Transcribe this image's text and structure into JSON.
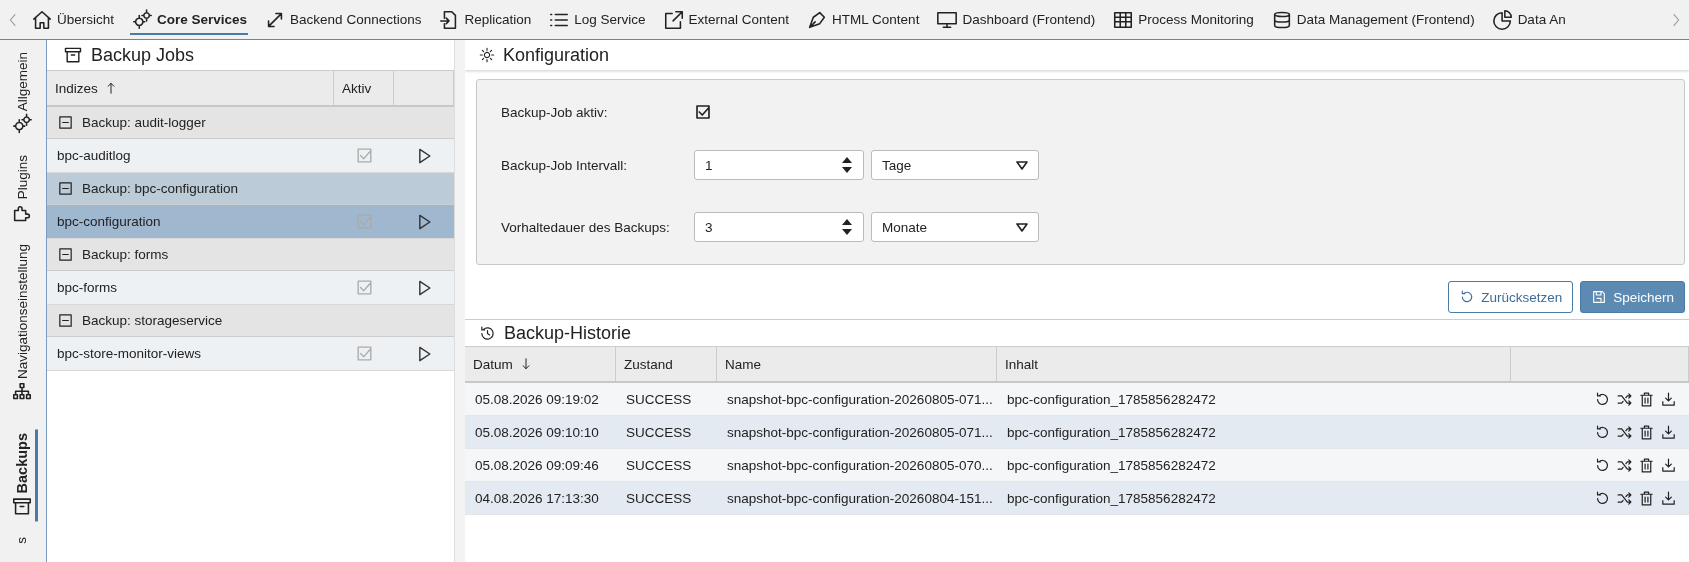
{
  "tab_bar": {
    "tabs": [
      {
        "label": "Übersicht",
        "selected": false
      },
      {
        "label": "Core Services",
        "selected": true
      },
      {
        "label": "Backend Connections",
        "selected": false
      },
      {
        "label": "Replication",
        "selected": false
      },
      {
        "label": "Log Service",
        "selected": false
      },
      {
        "label": "External Content",
        "selected": false
      },
      {
        "label": "HTML Content",
        "selected": false
      },
      {
        "label": "Dashboard (Frontend)",
        "selected": false
      },
      {
        "label": "Process Monitoring",
        "selected": false
      },
      {
        "label": "Data Management (Frontend)",
        "selected": false
      },
      {
        "label": "Data An",
        "selected": false
      }
    ]
  },
  "side_nav": {
    "items": [
      {
        "label": "Allgemein",
        "selected": false
      },
      {
        "label": "Plugins",
        "selected": false
      },
      {
        "label": "Navigationseinstellung",
        "selected": false
      },
      {
        "label": "Backups",
        "selected": true
      },
      {
        "label": "s",
        "selected": false
      }
    ]
  },
  "backup_jobs": {
    "title": "Backup Jobs",
    "columns": [
      {
        "label": "Indizes",
        "sorted": true,
        "ascending": true
      },
      {
        "label": "Aktiv",
        "sorted": false
      }
    ],
    "groups": [
      {
        "label": "Backup: audit-logger",
        "expanded": true,
        "jobs": [
          {
            "name": "bpc-auditlog",
            "active": true,
            "selected": false
          }
        ]
      },
      {
        "label": "Backup: bpc-configuration",
        "expanded": true,
        "jobs": [
          {
            "name": "bpc-configuration",
            "active": true,
            "selected": true
          }
        ]
      },
      {
        "label": "Backup: forms",
        "expanded": true,
        "jobs": [
          {
            "name": "bpc-forms",
            "active": true,
            "selected": false
          }
        ]
      },
      {
        "label": "Backup: storageservice",
        "expanded": true,
        "jobs": [
          {
            "name": "bpc-store-monitor-views",
            "active": true,
            "selected": false
          }
        ]
      }
    ]
  },
  "configuration": {
    "title": "Konfiguration",
    "active_label": "Backup-Job aktiv:",
    "active": true,
    "interval_label": "Backup-Job Intervall:",
    "interval_value": "1",
    "interval_unit": "Tage",
    "retention_label": "Vorhaltedauer des Backups:",
    "retention_value": "3",
    "retention_unit": "Monate",
    "buttons": [
      {
        "label": "Zurücksetzen",
        "kind": "secondary"
      },
      {
        "label": "Speichern",
        "kind": "primary"
      }
    ]
  },
  "backup_history": {
    "title": "Backup-Historie",
    "columns": [
      {
        "label": "Datum",
        "sorted": true,
        "ascending": false
      },
      {
        "label": "Zustand",
        "sorted": false
      },
      {
        "label": "Name",
        "sorted": false
      },
      {
        "label": "Inhalt",
        "sorted": false
      }
    ],
    "rows": [
      {
        "datum": "05.08.2026 09:19:02",
        "zustand": "SUCCESS",
        "name": "snapshot-bpc-configuration-20260805-071...",
        "inhalt": "bpc-configuration_1785856282472"
      },
      {
        "datum": "05.08.2026 09:10:10",
        "zustand": "SUCCESS",
        "name": "snapshot-bpc-configuration-20260805-071...",
        "inhalt": "bpc-configuration_1785856282472"
      },
      {
        "datum": "05.08.2026 09:09:46",
        "zustand": "SUCCESS",
        "name": "snapshot-bpc-configuration-20260805-070...",
        "inhalt": "bpc-configuration_1785856282472"
      },
      {
        "datum": "04.08.2026 17:13:30",
        "zustand": "SUCCESS",
        "name": "snapshot-bpc-configuration-20260804-151...",
        "inhalt": "bpc-configuration_1785856282472"
      }
    ]
  }
}
